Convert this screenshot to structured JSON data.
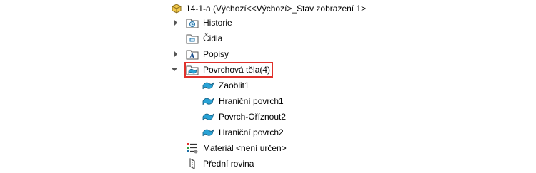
{
  "tree": {
    "root": {
      "label": "14-1-a  (Výchozí<<Výchozí>_Stav zobrazení 1>",
      "icon": "part-icon"
    },
    "items": [
      {
        "label": "Historie",
        "icon": "history-folder-icon",
        "expander": "collapsed"
      },
      {
        "label": "Čidla",
        "icon": "sensors-folder-icon",
        "expander": "none"
      },
      {
        "label": "Popisy",
        "icon": "annotations-folder-icon",
        "expander": "collapsed"
      },
      {
        "label": "Povrchová těla(4)",
        "icon": "surface-bodies-folder-icon",
        "expander": "expanded",
        "highlighted": true
      },
      {
        "label": "Zaoblit1",
        "icon": "surface-body-icon",
        "child": true
      },
      {
        "label": "Hraniční povrch1",
        "icon": "surface-body-icon",
        "child": true
      },
      {
        "label": "Povrch-Oříznout2",
        "icon": "surface-body-icon",
        "child": true
      },
      {
        "label": "Hraniční povrch2",
        "icon": "surface-body-icon",
        "child": true
      },
      {
        "label": "Materiál <není určen>",
        "icon": "material-icon",
        "expander": "none"
      },
      {
        "label": "Přední rovina",
        "icon": "plane-icon",
        "expander": "none"
      }
    ]
  },
  "colors": {
    "highlight": "#e0312b",
    "surface": "#29a3d6",
    "folder": "#d9b25a"
  }
}
